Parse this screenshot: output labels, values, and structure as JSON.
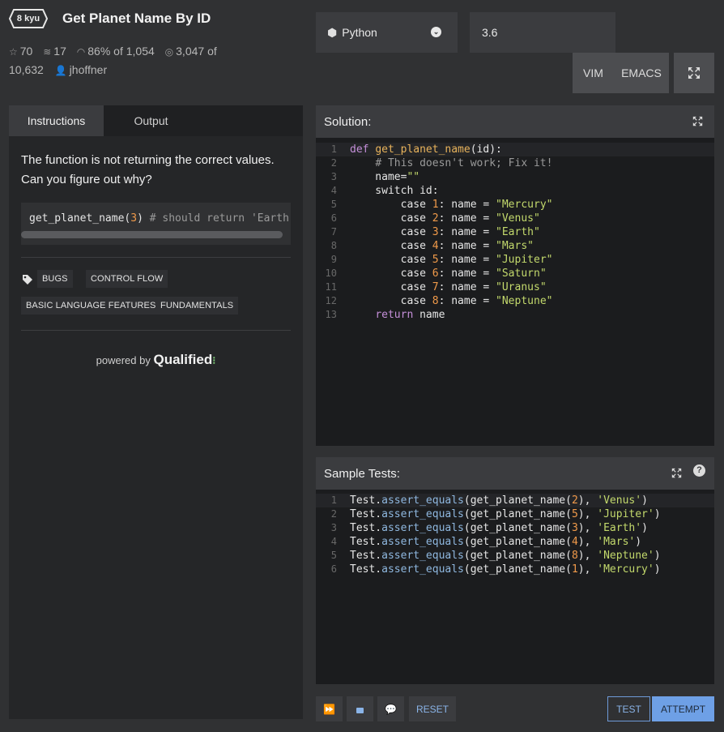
{
  "kata": {
    "rank": "8 kyu",
    "title": "Get Planet Name By ID",
    "stars": "70",
    "collections": "17",
    "satisfaction": "86% of 1,054",
    "completions_line1": "3,047 of",
    "completions_line2": "10,632",
    "author": "jhoffner"
  },
  "language": {
    "selected": "Python",
    "version": "3.6"
  },
  "editor_modes": [
    "VIM",
    "EMACS"
  ],
  "tabs": [
    "Instructions",
    "Output"
  ],
  "instructions": {
    "text": "The function is not returning the correct values. Can you figure out why?",
    "example_code": "get_planet_name(",
    "example_arg": "3",
    "example_close": ") ",
    "example_comment": "# should return 'Earth'"
  },
  "tags": [
    "BUGS",
    "CONTROL FLOW",
    "BASIC LANGUAGE FEATURES",
    "FUNDAMENTALS"
  ],
  "powered_by": {
    "prefix": "powered by",
    "brand": "Qualified"
  },
  "solution": {
    "label": "Solution:",
    "line_numbers": [
      "1",
      "2",
      "3",
      "4",
      "5",
      "6",
      "7",
      "8",
      "9",
      "10",
      "11",
      "12",
      "13"
    ]
  },
  "sample_tests": {
    "label": "Sample Tests:",
    "line_numbers": [
      "1",
      "2",
      "3",
      "4",
      "5",
      "6"
    ]
  },
  "actions": {
    "reset": "RESET",
    "test": "TEST",
    "attempt": "ATTEMPT"
  },
  "colors": {
    "accent": "#6ea0e6",
    "keyword": "#c58fd9",
    "function": "#e8b35b",
    "string": "#c3d96c",
    "number": "#f09a4a"
  }
}
